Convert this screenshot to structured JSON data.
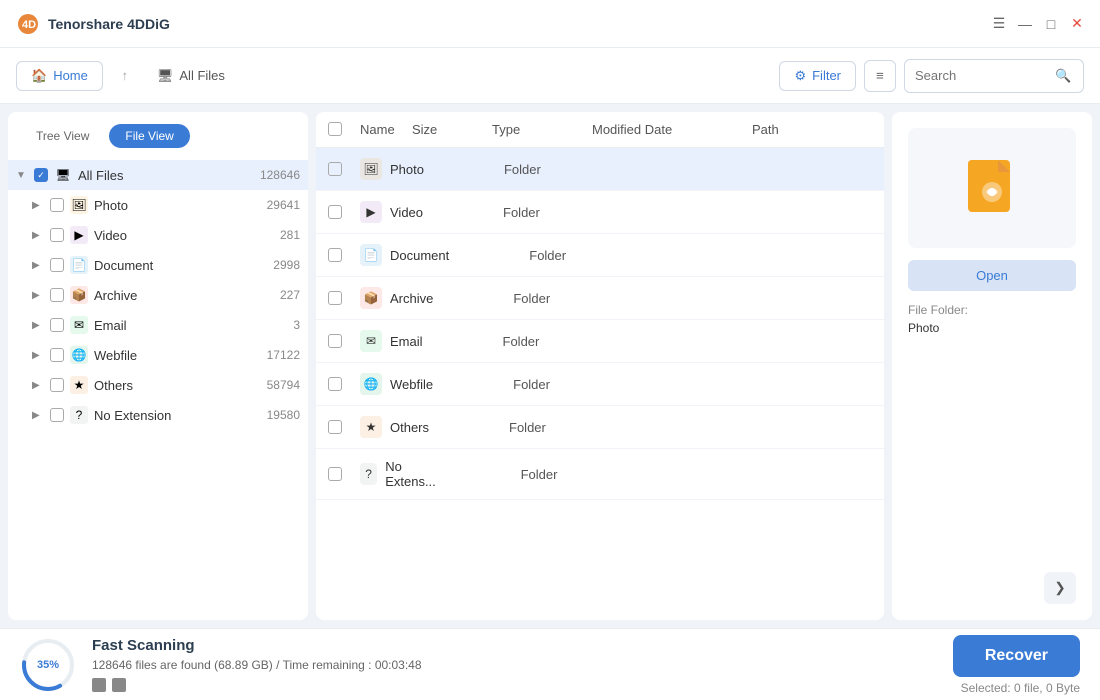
{
  "app": {
    "title": "Tenorshare 4DDiG",
    "logo_color": "#e8873a"
  },
  "titlebar": {
    "menu_icon": "☰",
    "minimize_icon": "—",
    "maximize_icon": "□",
    "close_icon": "✕"
  },
  "topnav": {
    "home_label": "Home",
    "all_files_label": "All Files",
    "filter_label": "Filter",
    "search_placeholder": "Search"
  },
  "sidebar": {
    "tree_view_label": "Tree View",
    "file_view_label": "File View",
    "root_label": "All Files",
    "root_count": "128646",
    "items": [
      {
        "name": "Photo",
        "count": "29641",
        "color": "#f5a623",
        "icon": "🖼"
      },
      {
        "name": "Video",
        "count": "281",
        "color": "#9b59b6",
        "icon": "▶"
      },
      {
        "name": "Document",
        "count": "2998",
        "color": "#3498db",
        "icon": "📄"
      },
      {
        "name": "Archive",
        "count": "227",
        "color": "#e74c3c",
        "icon": "📦"
      },
      {
        "name": "Email",
        "count": "3",
        "color": "#2ecc71",
        "icon": "✉"
      },
      {
        "name": "Webfile",
        "count": "17122",
        "color": "#27ae60",
        "icon": "🌐"
      },
      {
        "name": "Others",
        "count": "58794",
        "color": "#e67e22",
        "icon": "★"
      },
      {
        "name": "No Extension",
        "count": "19580",
        "color": "#95a5a6",
        "icon": "?"
      }
    ]
  },
  "table": {
    "columns": [
      "Name",
      "Size",
      "Type",
      "Modified Date",
      "Path"
    ],
    "rows": [
      {
        "name": "Photo",
        "size": "",
        "type": "Folder",
        "modified": "",
        "path": "",
        "icon_color": "#f5a623",
        "icon": "🖼",
        "selected": true
      },
      {
        "name": "Video",
        "size": "",
        "type": "Folder",
        "modified": "",
        "path": "",
        "icon_color": "#9b59b6",
        "icon": "▶",
        "selected": false
      },
      {
        "name": "Document",
        "size": "",
        "type": "Folder",
        "modified": "",
        "path": "",
        "icon_color": "#3498db",
        "icon": "📄",
        "selected": false
      },
      {
        "name": "Archive",
        "size": "",
        "type": "Folder",
        "modified": "",
        "path": "",
        "icon_color": "#e74c3c",
        "icon": "📦",
        "selected": false
      },
      {
        "name": "Email",
        "size": "",
        "type": "Folder",
        "modified": "",
        "path": "",
        "icon_color": "#2ecc71",
        "icon": "✉",
        "selected": false
      },
      {
        "name": "Webfile",
        "size": "",
        "type": "Folder",
        "modified": "",
        "path": "",
        "icon_color": "#27ae60",
        "icon": "🌐",
        "selected": false
      },
      {
        "name": "Others",
        "size": "",
        "type": "Folder",
        "modified": "",
        "path": "",
        "icon_color": "#e67e22",
        "icon": "★",
        "selected": false
      },
      {
        "name": "No Extens...",
        "size": "",
        "type": "Folder",
        "modified": "",
        "path": "",
        "icon_color": "#95a5a6",
        "icon": "?",
        "selected": false
      }
    ]
  },
  "preview": {
    "open_label": "Open",
    "file_folder_label": "File Folder:",
    "file_name": "Photo",
    "arrow_icon": "❯"
  },
  "bottombar": {
    "progress_percent": "35%",
    "scan_title": "Fast Scanning",
    "scan_detail": "128646 files are found (68.89 GB) /  Time remaining : 00:03:48",
    "recover_label": "Recover",
    "selected_info": "Selected: 0 file, 0 Byte"
  }
}
